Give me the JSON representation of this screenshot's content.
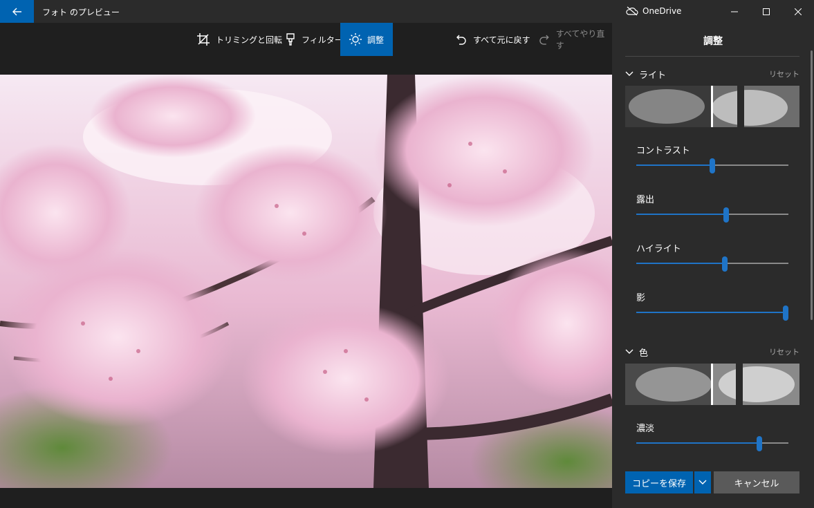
{
  "window": {
    "title": "フォト のプレビュー",
    "onedrive_label": "OneDrive"
  },
  "toolbar": {
    "crop_label": "トリミングと回転",
    "filter_label": "フィルター",
    "adjust_label": "調整",
    "undo_all_label": "すべて元に戻す",
    "redo_all_label": "すべてやり直す"
  },
  "pane": {
    "title": "調整",
    "light": {
      "label": "ライト",
      "reset": "リセット",
      "sliders": [
        {
          "label": "コントラスト",
          "value": 0.5
        },
        {
          "label": "露出",
          "value": 0.59
        },
        {
          "label": "ハイライト",
          "value": 0.58
        },
        {
          "label": "影",
          "value": 0.98
        }
      ]
    },
    "color": {
      "label": "色",
      "reset": "リセット",
      "sliders": [
        {
          "label": "濃淡",
          "value": 0.81
        }
      ]
    }
  },
  "buttons": {
    "save_copy": "コピーを保存",
    "cancel": "キャンセル"
  },
  "colors": {
    "accent": "#0063b1",
    "pane_bg": "#2b2b2b",
    "canvas_bg": "#1f1f1f"
  }
}
